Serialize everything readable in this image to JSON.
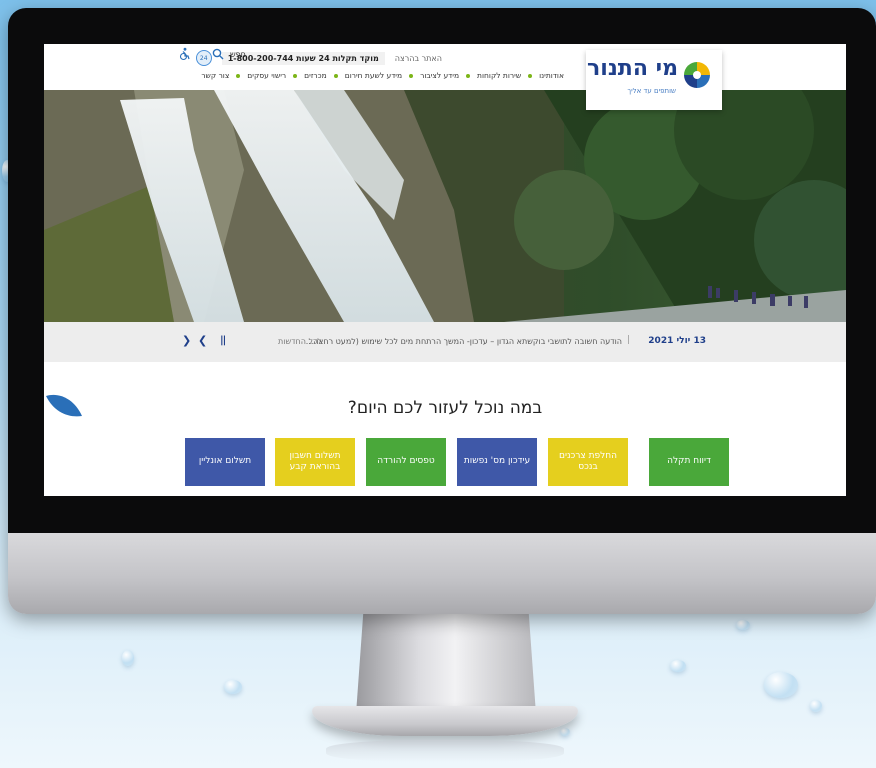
{
  "header": {
    "logo_text": "מי התנור",
    "logo_tagline": "שותפים עד אליך",
    "site_lang": "האתר בהרצה",
    "hotline": "מוקד תקלות 24 שעות 1-800-200-744",
    "hotline_icon": "24",
    "search_label": "חפש",
    "nav": [
      "אודותינו",
      "שירות לקוחות",
      "מידע לציבור",
      "מידע לשעת חירום",
      "מכרזים",
      "רישוי עסקים",
      "צור קשר"
    ]
  },
  "ticker": {
    "date": "13 יולי 2021",
    "separator": "|",
    "headline": "הודעה חשובה לתושבי בוקשתא הגדון – עדכון- המשך הרתחת מים לכל שימוש (למעט רחצה...",
    "all_news": "לכל החדשות",
    "pause": "||",
    "prev": "❮",
    "next": "❯"
  },
  "help": {
    "title": "במה נוכל לעזור לכם היום?",
    "tiles": [
      {
        "label": "דיווח תקלה",
        "color": "#4aa83a"
      },
      {
        "label": "החלפת צרכנים בנכס",
        "color": "#e5cf1e"
      },
      {
        "label": "עידכון מס' נפשות",
        "color": "#3f58a8"
      },
      {
        "label": "טפסים להורדה",
        "color": "#4aa83a"
      },
      {
        "label": "תשלום חשבון בהוראת קבע",
        "color": "#e5cf1e"
      },
      {
        "label": "תשלום אונליין",
        "color": "#3f58a8"
      }
    ]
  },
  "colors": {
    "brand_blue": "#1f3f8a",
    "accent_green": "#7cb518"
  }
}
